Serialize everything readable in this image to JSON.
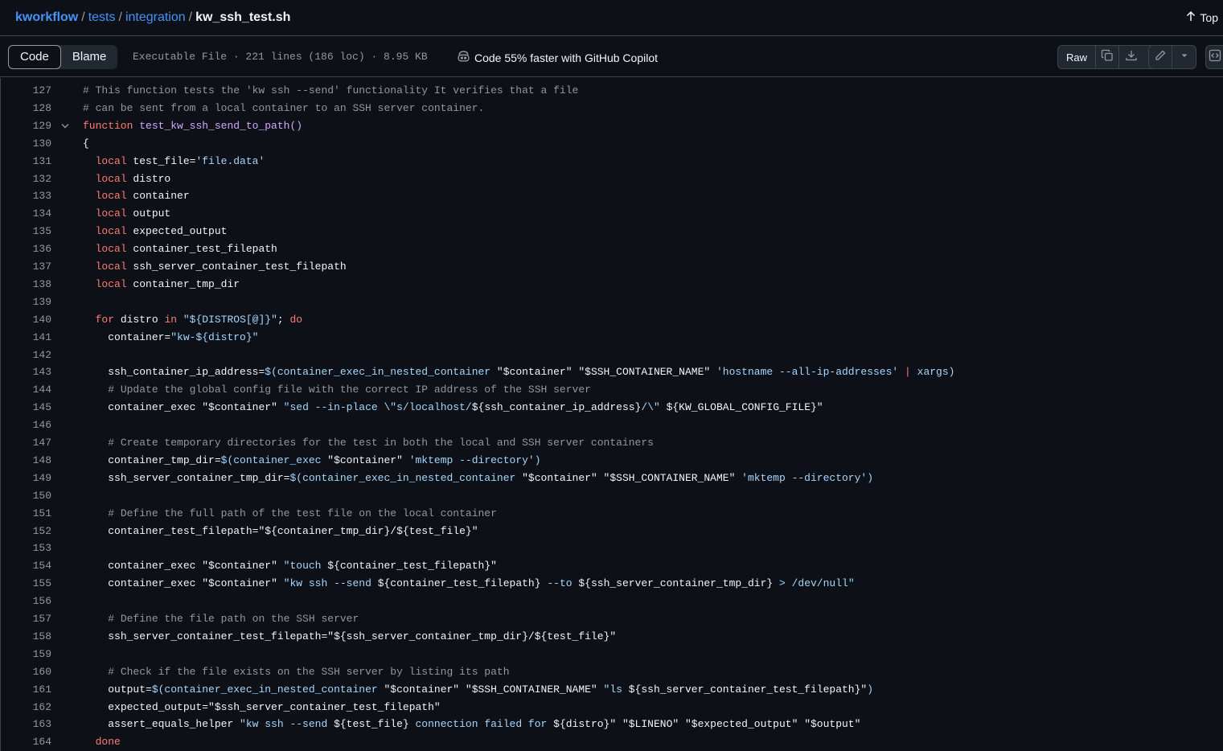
{
  "breadcrumb": {
    "repo": "kworkflow",
    "segments": [
      "tests",
      "integration"
    ],
    "file": "kw_ssh_test.sh",
    "separator": "/"
  },
  "top_link": "Top",
  "toolbar": {
    "tabs": [
      "Code",
      "Blame"
    ],
    "active_tab": "Code",
    "file_info": "Executable File · 221 lines (186 loc) · 8.95 KB",
    "copilot_label": "Code 55% faster with GitHub Copilot",
    "raw_label": "Raw",
    "icons": [
      "copy-icon",
      "download-icon",
      "pencil-icon",
      "triangle-down-icon",
      "code-square-icon"
    ]
  },
  "colors": {
    "background": "#0d1117",
    "comment": "#9198a1",
    "keyword": "#ff7b72",
    "function": "#d2a8ff",
    "string": "#a5d6ff",
    "text": "#f0f6fc",
    "link": "#4493f8"
  },
  "code": {
    "folded_line": 129,
    "lines": [
      {
        "n": "127",
        "indent": "",
        "tokens": [
          [
            "cm",
            "# This function tests the 'kw ssh --send' functionality It verifies that a file"
          ]
        ]
      },
      {
        "n": "128",
        "indent": "",
        "tokens": [
          [
            "cm",
            "# can be sent from a local container to an SSH server container."
          ]
        ]
      },
      {
        "n": "129",
        "indent": "",
        "tokens": [
          [
            "kw",
            "function"
          ],
          [
            "pl",
            " "
          ],
          [
            "fn",
            "test_kw_ssh_send_to_path()"
          ]
        ]
      },
      {
        "n": "130",
        "indent": "",
        "tokens": [
          [
            "pl",
            "{"
          ]
        ]
      },
      {
        "n": "131",
        "indent": "  ",
        "tokens": [
          [
            "kw",
            "local"
          ],
          [
            "pl",
            " test_file="
          ],
          [
            "st",
            "'file.data'"
          ]
        ]
      },
      {
        "n": "132",
        "indent": "  ",
        "tokens": [
          [
            "kw",
            "local"
          ],
          [
            "pl",
            " distro"
          ]
        ]
      },
      {
        "n": "133",
        "indent": "  ",
        "tokens": [
          [
            "kw",
            "local"
          ],
          [
            "pl",
            " container"
          ]
        ]
      },
      {
        "n": "134",
        "indent": "  ",
        "tokens": [
          [
            "kw",
            "local"
          ],
          [
            "pl",
            " output"
          ]
        ]
      },
      {
        "n": "135",
        "indent": "  ",
        "tokens": [
          [
            "kw",
            "local"
          ],
          [
            "pl",
            " expected_output"
          ]
        ]
      },
      {
        "n": "136",
        "indent": "  ",
        "tokens": [
          [
            "kw",
            "local"
          ],
          [
            "pl",
            " container_test_filepath"
          ]
        ]
      },
      {
        "n": "137",
        "indent": "  ",
        "tokens": [
          [
            "kw",
            "local"
          ],
          [
            "pl",
            " ssh_server_container_test_filepath"
          ]
        ]
      },
      {
        "n": "138",
        "indent": "  ",
        "tokens": [
          [
            "kw",
            "local"
          ],
          [
            "pl",
            " container_tmp_dir"
          ]
        ]
      },
      {
        "n": "139",
        "indent": "",
        "tokens": []
      },
      {
        "n": "140",
        "indent": "  ",
        "tokens": [
          [
            "kw",
            "for"
          ],
          [
            "pl",
            " distro "
          ],
          [
            "kw",
            "in"
          ],
          [
            "pl",
            " "
          ],
          [
            "st",
            "\"${DISTROS[@]}\""
          ],
          [
            "pl",
            "; "
          ],
          [
            "kw",
            "do"
          ]
        ]
      },
      {
        "n": "141",
        "indent": "    ",
        "tokens": [
          [
            "pl",
            "container="
          ],
          [
            "st",
            "\"kw-${distro}\""
          ]
        ]
      },
      {
        "n": "142",
        "indent": "",
        "tokens": []
      },
      {
        "n": "143",
        "indent": "    ",
        "tokens": [
          [
            "pl",
            "ssh_container_ip_address="
          ],
          [
            "st",
            "$(container_exec_in_nested_container "
          ],
          [
            "pl",
            "\"$container\" \"$SSH_CONTAINER_NAME\" "
          ],
          [
            "st",
            "'hostname --all-ip-addresses'"
          ],
          [
            "pl",
            " "
          ],
          [
            "op",
            "|"
          ],
          [
            "st",
            " xargs)"
          ]
        ]
      },
      {
        "n": "144",
        "indent": "    ",
        "tokens": [
          [
            "cm",
            "# Update the global config file with the correct IP address of the SSH server"
          ]
        ]
      },
      {
        "n": "145",
        "indent": "    ",
        "tokens": [
          [
            "pl",
            "container_exec "
          ],
          [
            "pl",
            "\"$container\" "
          ],
          [
            "st",
            "\"sed --in-place \\\"s/localhost/"
          ],
          [
            "pl",
            "${ssh_container_ip_address}"
          ],
          [
            "st",
            "/\\\" "
          ],
          [
            "pl",
            "${KW_GLOBAL_CONFIG_FILE}\""
          ]
        ]
      },
      {
        "n": "146",
        "indent": "",
        "tokens": []
      },
      {
        "n": "147",
        "indent": "    ",
        "tokens": [
          [
            "cm",
            "# Create temporary directories for the test in both the local and SSH server containers"
          ]
        ]
      },
      {
        "n": "148",
        "indent": "    ",
        "tokens": [
          [
            "pl",
            "container_tmp_dir="
          ],
          [
            "st",
            "$(container_exec "
          ],
          [
            "pl",
            "\"$container\" "
          ],
          [
            "st",
            "'mktemp --directory')"
          ]
        ]
      },
      {
        "n": "149",
        "indent": "    ",
        "tokens": [
          [
            "pl",
            "ssh_server_container_tmp_dir="
          ],
          [
            "st",
            "$(container_exec_in_nested_container "
          ],
          [
            "pl",
            "\"$container\" \"$SSH_CONTAINER_NAME\" "
          ],
          [
            "st",
            "'mktemp --directory')"
          ]
        ]
      },
      {
        "n": "150",
        "indent": "",
        "tokens": []
      },
      {
        "n": "151",
        "indent": "    ",
        "tokens": [
          [
            "cm",
            "# Define the full path of the test file on the local container"
          ]
        ]
      },
      {
        "n": "152",
        "indent": "    ",
        "tokens": [
          [
            "pl",
            "container_test_filepath="
          ],
          [
            "pl",
            "\"${container_tmp_dir}/${test_file}\""
          ]
        ]
      },
      {
        "n": "153",
        "indent": "",
        "tokens": []
      },
      {
        "n": "154",
        "indent": "    ",
        "tokens": [
          [
            "pl",
            "container_exec "
          ],
          [
            "pl",
            "\"$container\" "
          ],
          [
            "st",
            "\"touch "
          ],
          [
            "pl",
            "${container_test_filepath}\""
          ]
        ]
      },
      {
        "n": "155",
        "indent": "    ",
        "tokens": [
          [
            "pl",
            "container_exec "
          ],
          [
            "pl",
            "\"$container\" "
          ],
          [
            "st",
            "\"kw ssh --send "
          ],
          [
            "pl",
            "${container_test_filepath} "
          ],
          [
            "st",
            "--to "
          ],
          [
            "pl",
            "${ssh_server_container_tmp_dir} "
          ],
          [
            "st",
            "> /dev/null\""
          ]
        ]
      },
      {
        "n": "156",
        "indent": "",
        "tokens": []
      },
      {
        "n": "157",
        "indent": "    ",
        "tokens": [
          [
            "cm",
            "# Define the file path on the SSH server"
          ]
        ]
      },
      {
        "n": "158",
        "indent": "    ",
        "tokens": [
          [
            "pl",
            "ssh_server_container_test_filepath="
          ],
          [
            "pl",
            "\"${ssh_server_container_tmp_dir}/${test_file}\""
          ]
        ]
      },
      {
        "n": "159",
        "indent": "",
        "tokens": []
      },
      {
        "n": "160",
        "indent": "    ",
        "tokens": [
          [
            "cm",
            "# Check if the file exists on the SSH server by listing its path"
          ]
        ]
      },
      {
        "n": "161",
        "indent": "    ",
        "tokens": [
          [
            "pl",
            "output="
          ],
          [
            "st",
            "$(container_exec_in_nested_container "
          ],
          [
            "pl",
            "\"$container\" \"$SSH_CONTAINER_NAME\" "
          ],
          [
            "st",
            "\"ls "
          ],
          [
            "pl",
            "${ssh_server_container_test_filepath}\""
          ],
          [
            "st",
            ")"
          ]
        ]
      },
      {
        "n": "162",
        "indent": "    ",
        "tokens": [
          [
            "pl",
            "expected_output="
          ],
          [
            "pl",
            "\"$ssh_server_container_test_filepath\""
          ]
        ]
      },
      {
        "n": "163",
        "indent": "    ",
        "tokens": [
          [
            "pl",
            "assert_equals_helper "
          ],
          [
            "st",
            "\"kw ssh --send "
          ],
          [
            "pl",
            "${test_file} "
          ],
          [
            "st",
            "connection failed for "
          ],
          [
            "pl",
            "${distro}\" \"$LINENO\" \"$expected_output\" \"$output\""
          ]
        ]
      },
      {
        "n": "164",
        "indent": "  ",
        "tokens": [
          [
            "kw",
            "done"
          ]
        ]
      }
    ]
  }
}
